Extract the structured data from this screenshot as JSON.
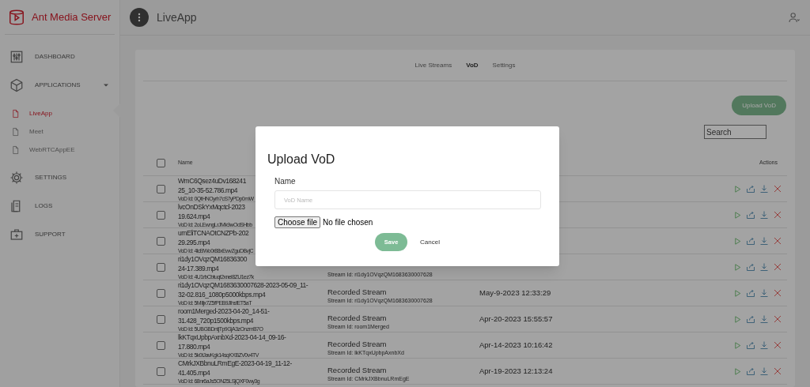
{
  "brand": "Ant Media Server",
  "header": {
    "title": "LiveApp"
  },
  "sidebar": {
    "items": [
      {
        "kind": "section",
        "label": "DASHBOARD",
        "selected": false
      },
      {
        "kind": "section",
        "label": "APPLICATIONS",
        "selected": false,
        "expanded": true,
        "children": [
          {
            "kind": "app",
            "label": "LiveApp",
            "selected": true
          },
          {
            "kind": "app",
            "label": "Meet",
            "selected": false
          },
          {
            "kind": "app",
            "label": "WebRTCAppEE",
            "selected": false
          }
        ]
      },
      {
        "kind": "section",
        "label": "SETTINGS",
        "selected": false
      },
      {
        "kind": "section",
        "label": "LOGS",
        "selected": false
      },
      {
        "kind": "section",
        "label": "SUPPORT",
        "selected": false
      }
    ]
  },
  "tabs": [
    {
      "label": "Live Streams",
      "selected": false
    },
    {
      "label": "VoD",
      "selected": true
    },
    {
      "label": "Settings",
      "selected": false
    }
  ],
  "upload_button": "Upload VoD",
  "search": {
    "placeholder": "Search"
  },
  "table": {
    "select_all_checked": false,
    "columns": [
      "Name",
      "Actions"
    ],
    "rows": [
      {
        "checked": false,
        "name": [
          "WmC6Qsez4uDv168241",
          "25_10-35-52.786.mp4"
        ],
        "vod_id": "VoD Id: 0QtHNOyrh7cS7yPDp0mW"
      },
      {
        "checked": false,
        "name": [
          "lvcOnDSkYxMqctcl-2023",
          "19.624.mp4"
        ],
        "vod_id": "VoD Id: 2oLEwngLrJMk9wOdSHbb"
      },
      {
        "checked": false,
        "name": [
          "umEliTCNAOtCNZPb-202",
          "29.295.mp4"
        ],
        "vod_id": "VoD Id: 4lcBWo0r88xEwvZguDBvjC"
      },
      {
        "checked": false,
        "name": [
          "ri1dy1OVqzQM16836300",
          "24-17.389.mp4"
        ],
        "vod_id": "VoD Id: 4U1rbCbtuqt2xnei8ZU1ez7k",
        "stream_id": "Stream Id: ri1dy1OVqzQM1683630007628"
      },
      {
        "checked": false,
        "name": [
          "ri1dy1OVqzQM1683630007628-2023-05-09_11-",
          "32-02.816_1080p5000kbps.mp4"
        ],
        "vod_id": "VoD Id: 5MIljx7Z5fPEB9JlhsfET5aT",
        "type": "Recorded Stream",
        "stream_id": "Stream Id: ri1dy1OVqzQM1683630007628",
        "date": "May-9-2023 12:33:29"
      },
      {
        "checked": false,
        "name": [
          "room1Merged-2023-04-20_14-51-",
          "31.428_720p1500kbps.mp4"
        ],
        "vod_id": "VoD Id: 5UBGBDntjTp9GjA3zOnzmB7O",
        "type": "Recorded Stream",
        "stream_id": "Stream Id: room1Merged",
        "date": "Apr-20-2023 15:55:57"
      },
      {
        "checked": false,
        "name": [
          "lkKTqxUpbpAxnbXd-2023-04-14_09-16-",
          "17.880.mp4"
        ],
        "vod_id": "VoD Id: 5k0tJavKgk14sqKXBZV0v4TV",
        "type": "Recorded Stream",
        "stream_id": "Stream Id: lkKTqxUpbpAxnbXd",
        "date": "Apr-14-2023 10:16:42"
      },
      {
        "checked": false,
        "name": [
          "CMrkJXBbnuLRmEgE-2023-04-19_11-12-",
          "41.405.mp4"
        ],
        "vod_id": "VoD Id: 68nr6aJs5ON25LSjQXF0wy3g",
        "type": "Recorded Stream",
        "stream_id": "Stream Id: CMrkJXBbnuLRmEgE",
        "date": "Apr-19-2023 12:13:24"
      }
    ]
  },
  "modal": {
    "title": "Upload VoD",
    "field_label": "Name",
    "placeholder": "VoD Name",
    "file_button": "Choose file",
    "file_status": "No file chosen",
    "save": "Save",
    "save_disabled": true,
    "cancel": "Cancel"
  }
}
